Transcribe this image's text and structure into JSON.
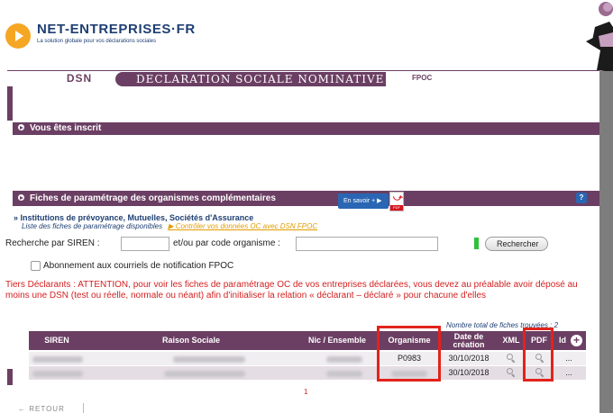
{
  "brand": {
    "title": "NET-ENTREPRISES·FR",
    "subtitle": "La solution globale pour vos déclarations sociales"
  },
  "nav": {
    "tab_dsn": "DSN",
    "tab_declaration": "DECLARATION SOCIALE NOMINATIVE",
    "tab_fpoc": "FPOC"
  },
  "sections": {
    "inscrit": "Vous êtes inscrit",
    "fiches": "Fiches de paramétrage des organismes complémentaires",
    "en_savoir": "En savoir +",
    "pdf_label": "PDF",
    "help": "?"
  },
  "institutions": {
    "title": "Institutions de prévoyance, Mutuelles, Sociétés d'Assurance",
    "subtitle": "Liste des fiches de paramétrage disponibles",
    "link": "Contrôler vos données OC avec DSN FPOC"
  },
  "search": {
    "siren_label": "Recherche par SIREN :",
    "org_label": "et/ou par code organisme :",
    "siren_value": "",
    "org_value": "",
    "button": "Rechercher"
  },
  "notification": {
    "label": "Abonnement aux courriels de notification FPOC",
    "checked": false
  },
  "warning": "Tiers Déclarants : ATTENTION, pour voir les fiches de paramétrage OC de vos entreprises déclarées, vous devez au préalable avoir déposé au moins une DSN (test ou réelle, normale ou néant) afin d'initialiser la relation « déclarant – déclaré » pour chacune d'elles",
  "table": {
    "total": "Nombre total de fiches trouvées : 2",
    "headers": [
      "SIREN",
      "Raison Sociale",
      "Nic / Ensemble",
      "Organisme",
      "Date de création",
      "XML",
      "PDF",
      "Id"
    ],
    "rows": [
      {
        "organisme": "P0983",
        "date": "30/10/2018",
        "id": "..."
      },
      {
        "organisme": "",
        "date": "30/10/2018",
        "id": "..."
      }
    ],
    "page": "1"
  },
  "footer": {
    "retour": "← RETOUR"
  },
  "colors": {
    "brand_purple": "#6b3f63",
    "brand_blue": "#1e3f73",
    "logo_orange": "#f5a623",
    "warning_red": "#d31f1f",
    "highlight_red": "#e2231a"
  }
}
